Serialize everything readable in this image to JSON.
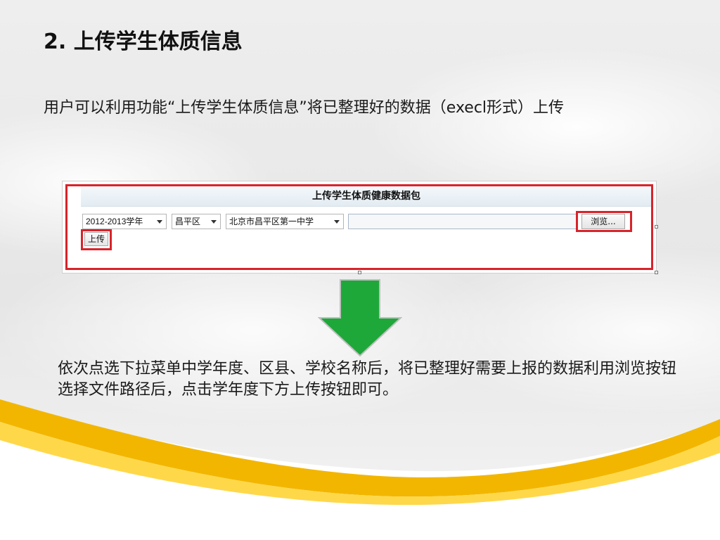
{
  "slide": {
    "title": "2.  上传学生体质信息",
    "intro": "用户可以利用功能“上传学生体质信息”将已整理好的数据（execl形式）上传",
    "description": "依次点选下拉菜单中学年度、区县、学校名称后，将已整理好需要上报的数据利用浏览按钮选择文件路径后，点击学年度下方上传按钮即可。"
  },
  "screenshot": {
    "title": "上传学生体质健康数据包",
    "year_select": "2012-2013学年",
    "district_select": "昌平区",
    "school_select": "北京市昌平区第一中学",
    "file_input_value": "",
    "browse_label": "浏览...",
    "upload_label": "上传"
  },
  "colors": {
    "highlight": "#d8232a",
    "arrow": "#1ea83a",
    "swoosh": "#f2b600"
  }
}
